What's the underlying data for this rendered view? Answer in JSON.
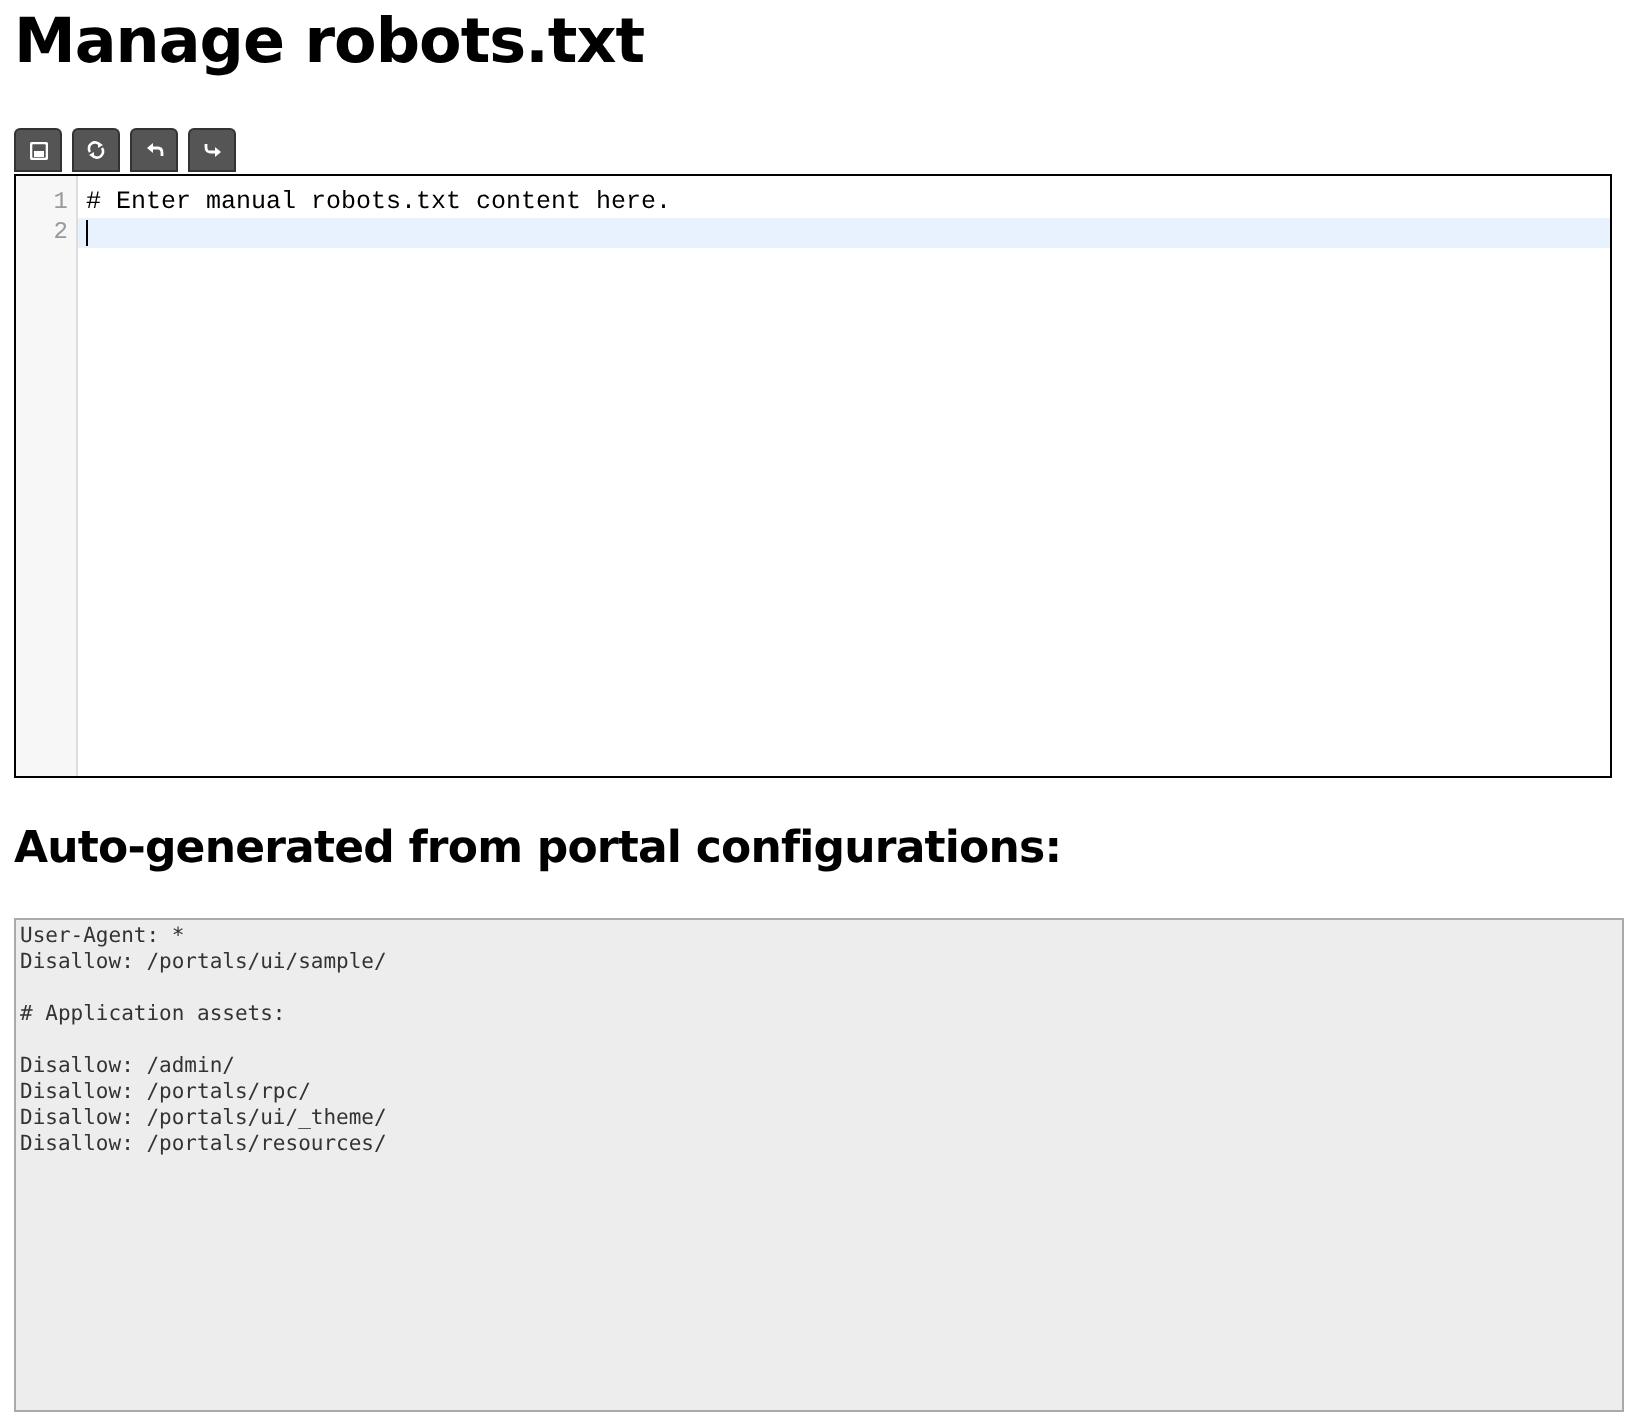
{
  "title": "Manage robots.txt",
  "toolbar": [
    {
      "kind": "save"
    },
    {
      "kind": "refresh"
    },
    {
      "kind": "undo"
    },
    {
      "kind": "redo"
    }
  ],
  "editor": {
    "lines": [
      {
        "number": "1",
        "text": "# Enter manual robots.txt content here.",
        "active": false
      },
      {
        "number": "2",
        "active": true
      }
    ]
  },
  "generated": {
    "heading": "Auto-generated from portal configurations:",
    "content": "User-Agent: *\nDisallow: /portals/ui/sample/\n\n# Application assets:\n\nDisallow: /admin/\nDisallow: /portals/rpc/\nDisallow: /portals/ui/_theme/\nDisallow: /portals/resources/"
  }
}
